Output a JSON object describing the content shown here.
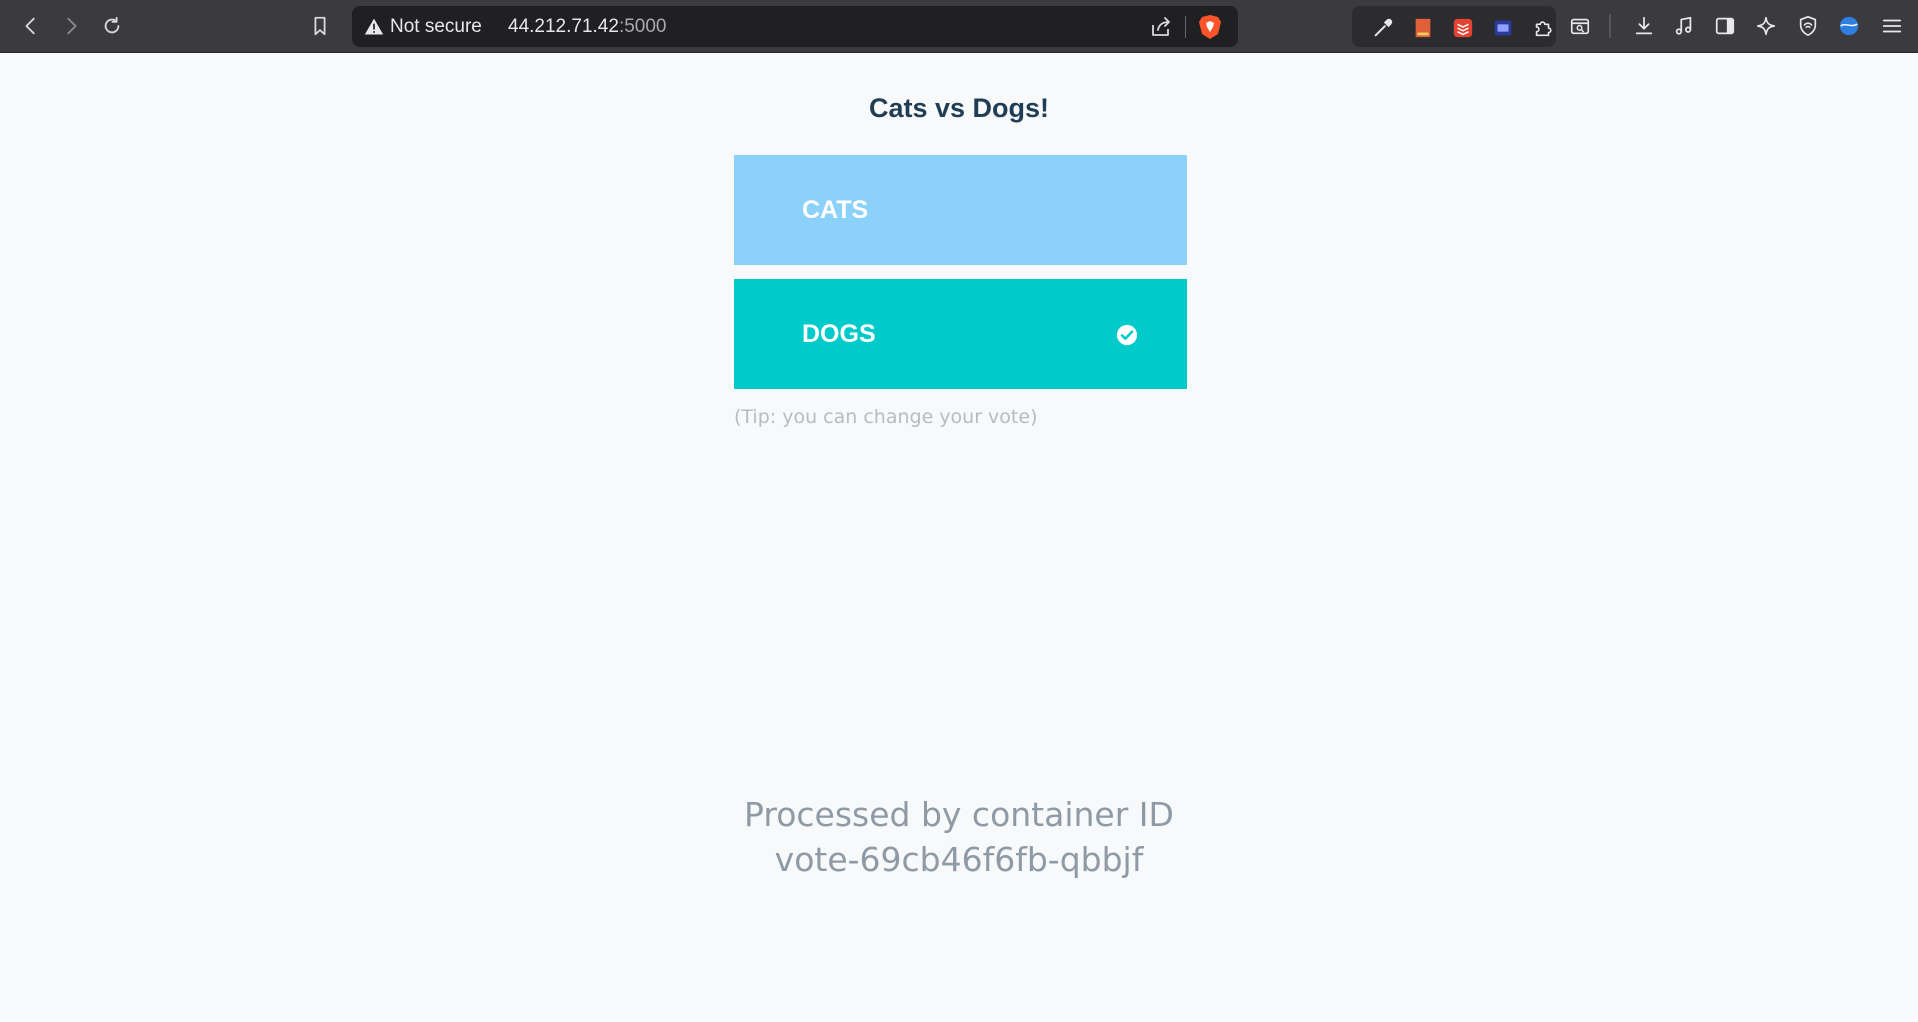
{
  "browser": {
    "security_label": "Not secure",
    "url_host": "44.212.71.42",
    "url_port": ":5000",
    "brand_color": "#fb542b"
  },
  "page": {
    "title": "Cats vs Dogs!",
    "options": [
      {
        "label": "CATS",
        "color": "#8cd1f9",
        "selected": false
      },
      {
        "label": "DOGS",
        "color": "#00cbca",
        "selected": true
      }
    ],
    "tip": "(Tip: you can change your vote)",
    "footer_line1": "Processed by container ID",
    "footer_line2": "vote-69cb46f6fb-qbbjf"
  }
}
